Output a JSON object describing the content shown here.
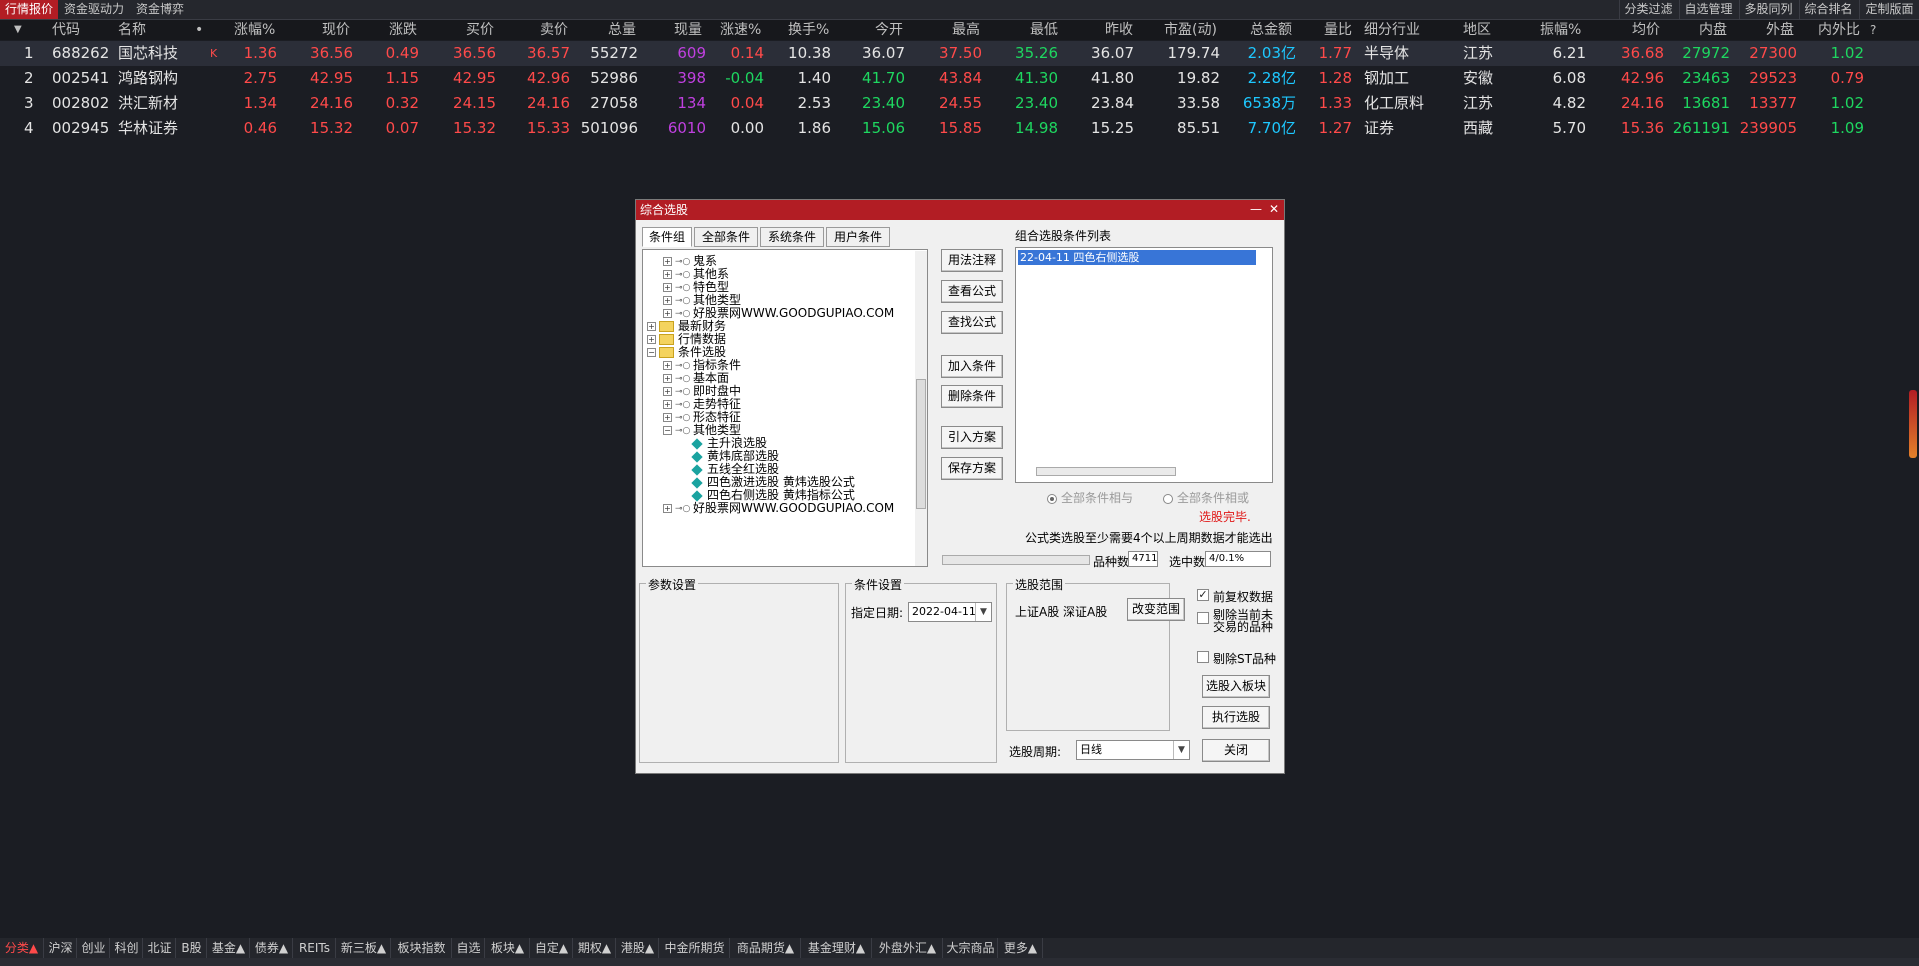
{
  "top_tabs": [
    {
      "label": "行情报价",
      "active": true
    },
    {
      "label": "资金驱动力"
    },
    {
      "label": "资金博弈"
    }
  ],
  "top_right_tabs": [
    "分类过滤",
    "自选管理",
    "多股同列",
    "综合排名",
    "定制版面"
  ],
  "table": {
    "columns": [
      "代码",
      "名称",
      "•",
      "涨幅%",
      "现价",
      "涨跌",
      "买价",
      "卖价",
      "总量",
      "现量",
      "涨速%",
      "换手%",
      "今开",
      "最高",
      "最低",
      "昨收",
      "市盈(动)",
      "总金额",
      "量比",
      "细分行业",
      "地区",
      "振幅%",
      "均价",
      "内盘",
      "外盘",
      "内外比",
      "?"
    ],
    "rows": [
      {
        "idx": "1",
        "code": "688262",
        "name": "国芯科技",
        "flag": "K",
        "chg_pct": "1.36",
        "price": "36.56",
        "chg": "0.49",
        "bid": "36.56",
        "ask": "36.57",
        "volume": "55272",
        "cur_vol": "609",
        "speed": "0.14",
        "turnover": "10.38",
        "open": "36.07",
        "high": "37.50",
        "low": "35.26",
        "prev": "36.07",
        "pe": "179.74",
        "amount": "2.03亿",
        "vol_ratio": "1.77",
        "industry": "半导体",
        "region": "江苏",
        "amplitude": "6.21",
        "avg": "36.68",
        "inner": "27972",
        "outer": "27300",
        "io_ratio": "1.02"
      },
      {
        "idx": "2",
        "code": "002541",
        "name": "鸿路钢构",
        "flag": "",
        "chg_pct": "2.75",
        "price": "42.95",
        "chg": "1.15",
        "bid": "42.95",
        "ask": "42.96",
        "volume": "52986",
        "cur_vol": "398",
        "speed": "-0.04",
        "turnover": "1.40",
        "open": "41.70",
        "high": "43.84",
        "low": "41.30",
        "prev": "41.80",
        "pe": "19.82",
        "amount": "2.28亿",
        "vol_ratio": "1.28",
        "industry": "钢加工",
        "region": "安徽",
        "amplitude": "6.08",
        "avg": "42.96",
        "inner": "23463",
        "outer": "29523",
        "io_ratio": "0.79"
      },
      {
        "idx": "3",
        "code": "002802",
        "name": "洪汇新材",
        "flag": "",
        "chg_pct": "1.34",
        "price": "24.16",
        "chg": "0.32",
        "bid": "24.15",
        "ask": "24.16",
        "volume": "27058",
        "cur_vol": "134",
        "speed": "0.04",
        "turnover": "2.53",
        "open": "23.40",
        "high": "24.55",
        "low": "23.40",
        "prev": "23.84",
        "pe": "33.58",
        "amount": "6538万",
        "vol_ratio": "1.33",
        "industry": "化工原料",
        "region": "江苏",
        "amplitude": "4.82",
        "avg": "24.16",
        "inner": "13681",
        "outer": "13377",
        "io_ratio": "1.02"
      },
      {
        "idx": "4",
        "code": "002945",
        "name": "华林证券",
        "flag": "",
        "chg_pct": "0.46",
        "price": "15.32",
        "chg": "0.07",
        "bid": "15.32",
        "ask": "15.33",
        "volume": "501096",
        "cur_vol": "6010",
        "speed": "0.00",
        "turnover": "1.86",
        "open": "15.06",
        "high": "15.85",
        "low": "14.98",
        "prev": "15.25",
        "pe": "85.51",
        "amount": "7.70亿",
        "vol_ratio": "1.27",
        "industry": "证券",
        "region": "西藏",
        "amplitude": "5.70",
        "avg": "15.36",
        "inner": "261191",
        "outer": "239905",
        "io_ratio": "1.09"
      }
    ]
  },
  "dialog": {
    "title": "综合选股",
    "tabs": [
      "条件组",
      "全部条件",
      "系统条件",
      "用户条件"
    ],
    "tree": [
      {
        "label": "鬼系",
        "type": "key"
      },
      {
        "label": "其他系",
        "type": "key"
      },
      {
        "label": "特色型",
        "type": "key"
      },
      {
        "label": "其他类型",
        "type": "key"
      },
      {
        "label": "好股票网WWW.GOODGUPIAO.COM",
        "type": "key"
      },
      {
        "label": "最新财务",
        "type": "folder"
      },
      {
        "label": "行情数据",
        "type": "folder"
      },
      {
        "label": "条件选股",
        "type": "folder"
      },
      {
        "label": "指标条件",
        "type": "key"
      },
      {
        "label": "基本面",
        "type": "key"
      },
      {
        "label": "即时盘中",
        "type": "key"
      },
      {
        "label": "走势特征",
        "type": "key"
      },
      {
        "label": "形态特征",
        "type": "key"
      },
      {
        "label": "其他类型",
        "type": "key"
      },
      {
        "label": "主升浪选股",
        "type": "gem"
      },
      {
        "label": "黄炜底部选股",
        "type": "gem"
      },
      {
        "label": "五线全红选股",
        "type": "gem"
      },
      {
        "label": "四色激进选股 黄炜选股公式",
        "type": "gem"
      },
      {
        "label": "四色右侧选股 黄炜指标公式",
        "type": "gem"
      },
      {
        "label": "好股票网WWW.GOODGUPIAO.COM",
        "type": "key"
      }
    ],
    "buttons": {
      "usage": "用法注释",
      "view": "查看公式",
      "find": "查找公式",
      "add": "加入条件",
      "delete": "删除条件",
      "import": "引入方案",
      "save": "保存方案",
      "change_range": "改变范围",
      "to_block": "选股入板块",
      "execute": "执行选股",
      "close": "关闭"
    },
    "list_label": "组合选股条件列表",
    "list_items": [
      "22-04-11 四色右侧选股"
    ],
    "radio_and": "全部条件相与",
    "radio_or": "全部条件相或",
    "status": "选股完毕.",
    "note": "公式类选股至少需要4个以上周期数据才能选出",
    "count_label": "品种数",
    "count_value": "4711",
    "selected_label": "选中数",
    "selected_value": "4/0.1%",
    "params_label": "参数设置",
    "cond_label": "条件设置",
    "date_label": "指定日期:",
    "date_value": "2022-04-11",
    "range_label": "选股范围",
    "range_value": "上证A股 深证A股",
    "chk_fq": "前复权数据",
    "chk_exclude_untraded": "剔除当前未交易的品种",
    "chk_exclude_st": "剔除ST品种",
    "period_label": "选股周期:",
    "period_value": "日线"
  },
  "bottom_tabs": [
    "分类▲",
    "沪深",
    "创业",
    "科创",
    "北证",
    "B股",
    "基金▲",
    "债券▲",
    "REITs",
    "新三板▲",
    "板块指数",
    "自选",
    "板块▲",
    "自定▲",
    "期权▲",
    "港股▲",
    "中金所期货",
    "商品期货▲",
    "基金理财▲",
    "外盘外汇▲",
    "大宗商品",
    "更多▲"
  ],
  "colors": {
    "up": "#ff4a4a",
    "down": "#1ed760",
    "accent": "#b21d24",
    "amount": "#1ec8ff",
    "volume": "#c040e0"
  }
}
